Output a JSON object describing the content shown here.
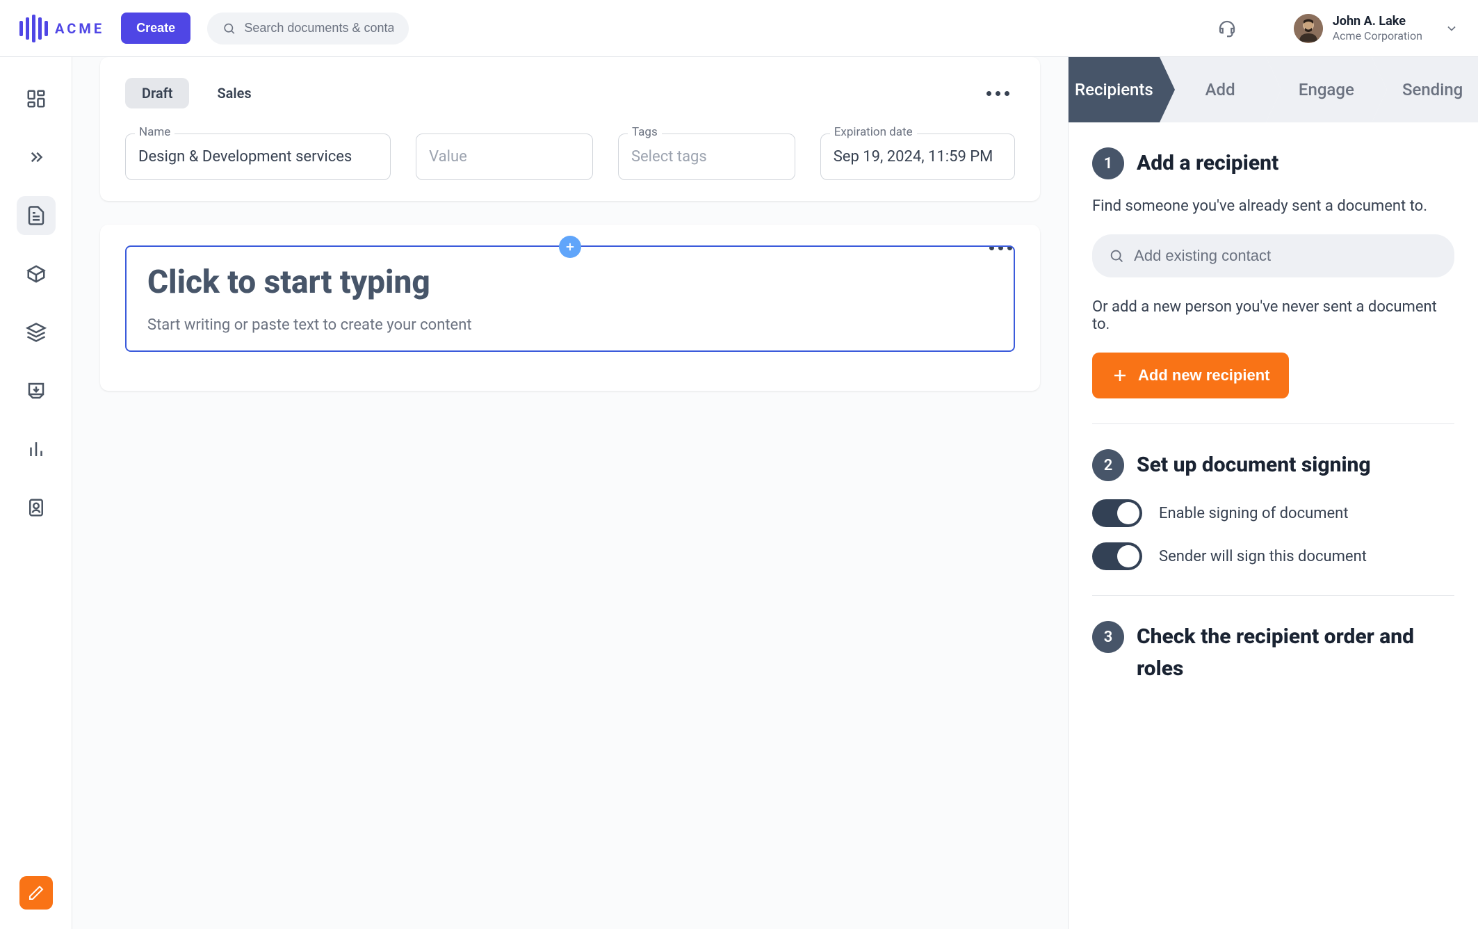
{
  "brand": {
    "name": "ACME"
  },
  "header": {
    "create_label": "Create",
    "search_placeholder": "Search documents & contacts",
    "user_name": "John A. Lake",
    "user_company": "Acme Corporation"
  },
  "doc_card": {
    "tabs": {
      "draft": "Draft",
      "sales": "Sales"
    },
    "fields": {
      "name_label": "Name",
      "name_value": "Design & Development services",
      "value_label": "Value",
      "value_placeholder": "",
      "tags_label": "Tags",
      "tags_placeholder": "Select tags",
      "exp_label": "Expiration date",
      "exp_value": "Sep 19, 2024, 11:59 PM"
    }
  },
  "editor": {
    "title": "Click to start typing",
    "subtitle": "Start writing or paste text to create your content"
  },
  "steps": {
    "recipients": "Recipients",
    "add": "Add",
    "engage": "Engage",
    "sending": "Sending"
  },
  "panel": {
    "s1_title": "Add a recipient",
    "s1_desc": "Find someone you've already sent a document to.",
    "contact_placeholder": "Add existing contact",
    "s1_or": "Or add a new person you've never sent a document to.",
    "add_new_label": "Add new recipient",
    "s2_title": "Set up document signing",
    "toggle1_label": "Enable signing of document",
    "toggle2_label": "Sender will sign this document",
    "s3_title": "Check the recipient order and roles"
  }
}
